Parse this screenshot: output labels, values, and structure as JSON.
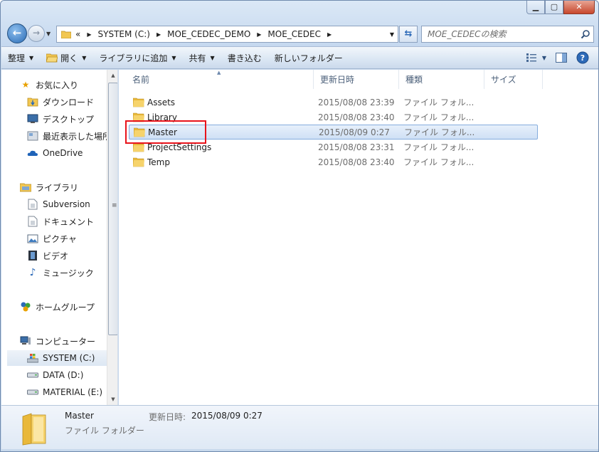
{
  "window": {
    "caption_min": "▁",
    "caption_max": "▢",
    "caption_close": "✕"
  },
  "address": {
    "overflow": "«",
    "crumbs": [
      "SYSTEM (C:)",
      "MOE_CEDEC_DEMO",
      "MOE_CEDEC"
    ]
  },
  "search": {
    "placeholder": "MOE_CEDECの検索"
  },
  "toolbar": {
    "organize": "整理",
    "open": "開く",
    "add_to_library": "ライブラリに追加",
    "share": "共有",
    "burn": "書き込む",
    "new_folder": "新しいフォルダー"
  },
  "nav": {
    "favorites": "お気に入り",
    "downloads": "ダウンロード",
    "desktop": "デスクトップ",
    "recent": "最近表示した場所",
    "onedrive": "OneDrive",
    "libraries": "ライブラリ",
    "subversion": "Subversion",
    "documents": "ドキュメント",
    "pictures": "ピクチャ",
    "videos": "ビデオ",
    "music": "ミュージック",
    "homegroup": "ホームグループ",
    "computer": "コンピューター",
    "drive_c": "SYSTEM (C:)",
    "drive_d": "DATA (D:)",
    "drive_e": "MATERIAL (E:)"
  },
  "columns": {
    "name": "名前",
    "date": "更新日時",
    "type": "種類",
    "size": "サイズ"
  },
  "files": [
    {
      "name": "Assets",
      "date": "2015/08/08 23:39",
      "type": "ファイル フォル..."
    },
    {
      "name": "Library",
      "date": "2015/08/08 23:40",
      "type": "ファイル フォル..."
    },
    {
      "name": "Master",
      "date": "2015/08/09 0:27",
      "type": "ファイル フォル..."
    },
    {
      "name": "ProjectSettings",
      "date": "2015/08/08 23:31",
      "type": "ファイル フォル..."
    },
    {
      "name": "Temp",
      "date": "2015/08/08 23:40",
      "type": "ファイル フォル..."
    }
  ],
  "details": {
    "name": "Master",
    "type": "ファイル フォルダー",
    "modified_label": "更新日時:",
    "modified_value": "2015/08/09 0:27"
  },
  "colors": {
    "folder": "#f2c752",
    "selection": "#cfe0f5",
    "highlight_box": "#e8131b",
    "accent": "#2a6bb5"
  }
}
